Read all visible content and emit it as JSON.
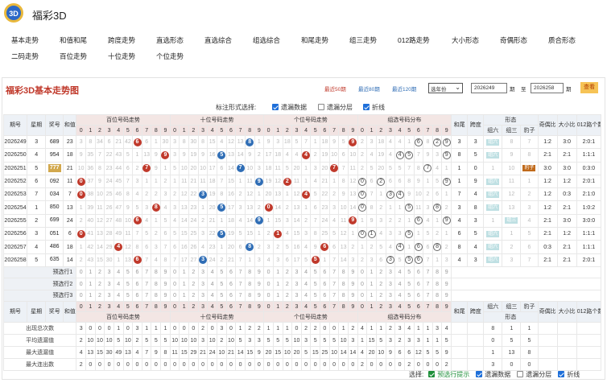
{
  "header": {
    "brand": "福彩3D",
    "logo_text": "3D"
  },
  "nav": {
    "row1": [
      "基本走势",
      "和值和尾",
      "跨度走势",
      "直选形态",
      "直选综合",
      "组选综合",
      "和尾走势",
      "组三走势",
      "012路走势",
      "大小形态",
      "奇偶形态",
      "质合形态"
    ],
    "row2": [
      "二码走势",
      "百位走势",
      "十位走势",
      "个位走势"
    ]
  },
  "panel": {
    "title": "福彩3D基本走势图",
    "recent": [
      "最近50期",
      "最近80期",
      "最近120期"
    ],
    "year_select": "选年份",
    "from_value": "2026249",
    "unit1": "期",
    "to_label": "至",
    "to_value": "2026258",
    "unit2": "期",
    "query": "查看"
  },
  "options": {
    "label": "标注形式选择:",
    "items": [
      {
        "label": "遗漏数据",
        "checked": true
      },
      {
        "label": "遗漏分层",
        "checked": false
      },
      {
        "label": "折线",
        "checked": true
      }
    ]
  },
  "table": {
    "h": {
      "qi": "期号",
      "week": "星期",
      "award": "奖号",
      "sum": "和值",
      "bai": "百位号码走势",
      "shi": "十位号码走势",
      "ge": "个位号码走势",
      "zuxuan": "组选号码分布",
      "hewei": "和尾",
      "kuadu": "跨度",
      "xingtai": "形态",
      "zu6": "组六",
      "zu3": "组三",
      "baozi": "豹子",
      "jo": "奇偶比",
      "dx": "大小比",
      "lu012": "012路个数比"
    },
    "digits": [
      "0",
      "1",
      "2",
      "3",
      "4",
      "5",
      "6",
      "7",
      "8",
      "9"
    ],
    "rows": [
      {
        "qi": "2026249",
        "week": "3",
        "award": "689",
        "sum": "23",
        "b": [
          "3",
          "8",
          "34",
          "6",
          "21",
          "42",
          "6",
          "6",
          "1",
          "30"
        ],
        "s": [
          "3",
          "8",
          "30",
          "8",
          "15",
          "4",
          "12",
          "13",
          "8",
          "1"
        ],
        "g": [
          "9",
          "3",
          "18",
          "5",
          "7",
          "1",
          "18",
          "9",
          "5",
          "9"
        ],
        "z": [
          "2",
          "3",
          "18",
          "4",
          "4",
          "1",
          "6",
          "8",
          "2",
          "9"
        ],
        "zc": [
          6,
          8,
          9
        ],
        "hw": "3",
        "kd": "3",
        "zu6": "组六",
        "zu3": "8",
        "bz": "7",
        "jo": "1:2",
        "dx": "3:0",
        "lu": "2:0:1"
      },
      {
        "qi": "2026250",
        "week": "4",
        "award": "954",
        "sum": "18",
        "b": [
          "9",
          "35",
          "7",
          "22",
          "43",
          "5",
          "1",
          "13",
          "9",
          "9"
        ],
        "s": [
          "3",
          "9",
          "19",
          "9",
          "16",
          "5",
          "13",
          "14",
          "9",
          "2"
        ],
        "g": [
          "17",
          "18",
          "4",
          "4",
          "4",
          "2",
          "19",
          "10",
          "6",
          "10"
        ],
        "z": [
          "2",
          "4",
          "19",
          "4",
          "4",
          "5",
          "7",
          "9",
          "3",
          "9"
        ],
        "zc": [
          4,
          5,
          9
        ],
        "hw": "8",
        "kd": "5",
        "zu6": "组六",
        "zu3": "9",
        "bz": "8",
        "jo": "2:1",
        "dx": "2:1",
        "lu": "1:1:1"
      },
      {
        "qi": "2026251",
        "week": "5",
        "award": "777",
        "sum": "21",
        "b": [
          "10",
          "36",
          "8",
          "23",
          "44",
          "6",
          "2",
          "7",
          "9",
          "1"
        ],
        "s": [
          "5",
          "10",
          "20",
          "10",
          "17",
          "6",
          "14",
          "7",
          "10",
          "3"
        ],
        "g": [
          "18",
          "11",
          "5",
          "20",
          "1",
          "3",
          "20",
          "7",
          "7",
          "11"
        ],
        "z": [
          "2",
          "5",
          "20",
          "5",
          "5",
          "7",
          "8",
          "7",
          "4",
          "1"
        ],
        "zc": [
          7
        ],
        "hw": "1",
        "kd": "0",
        "zu6": "1",
        "zu3": "10",
        "bz": "豹子",
        "jo": "3:0",
        "dx": "3:0",
        "lu": "0:3:0",
        "special": true
      },
      {
        "qi": "2026252",
        "week": "6",
        "award": "092",
        "sum": "11",
        "b": [
          "0",
          "37",
          "9",
          "24",
          "45",
          "7",
          "3",
          "1",
          "1",
          "2"
        ],
        "s": [
          "1",
          "11",
          "21",
          "11",
          "18",
          "7",
          "15",
          "1",
          "11",
          "9"
        ],
        "g": [
          "19",
          "12",
          "2",
          "11",
          "1",
          "4",
          "21",
          "1",
          "8",
          "12"
        ],
        "z": [
          "0",
          "6",
          "2",
          "6",
          "6",
          "8",
          "9",
          "1",
          "5",
          "9"
        ],
        "zc": [
          0,
          2,
          9
        ],
        "hw": "1",
        "kd": "9",
        "zu6": "组六",
        "zu3": "11",
        "bz": "1",
        "jo": "1:2",
        "dx": "1:2",
        "lu": "2:0:1"
      },
      {
        "qi": "2026253",
        "week": "7",
        "award": "034",
        "sum": "7",
        "b": [
          "0",
          "38",
          "10",
          "25",
          "46",
          "8",
          "4",
          "2",
          "2",
          "3"
        ],
        "s": [
          "2",
          "12",
          "22",
          "3",
          "19",
          "8",
          "16",
          "2",
          "12",
          "1"
        ],
        "g": [
          "20",
          "13",
          "1",
          "12",
          "4",
          "5",
          "22",
          "2",
          "9",
          "13"
        ],
        "z": [
          "0",
          "7",
          "1",
          "3",
          "4",
          "9",
          "10",
          "2",
          "6",
          "1"
        ],
        "zc": [
          0,
          3,
          4
        ],
        "hw": "7",
        "kd": "4",
        "zu6": "组六",
        "zu3": "12",
        "bz": "2",
        "jo": "1:2",
        "dx": "0:3",
        "lu": "2:1:0"
      },
      {
        "qi": "2026254",
        "week": "1",
        "award": "850",
        "sum": "13",
        "b": [
          "1",
          "39",
          "11",
          "26",
          "47",
          "9",
          "5",
          "3",
          "8",
          "4"
        ],
        "s": [
          "3",
          "13",
          "23",
          "1",
          "20",
          "5",
          "17",
          "3",
          "13",
          "2"
        ],
        "g": [
          "0",
          "14",
          "2",
          "13",
          "1",
          "6",
          "23",
          "3",
          "10",
          "14"
        ],
        "z": [
          "0",
          "8",
          "2",
          "1",
          "1",
          "5",
          "11",
          "3",
          "8",
          "2"
        ],
        "zc": [
          0,
          5,
          8
        ],
        "hw": "3",
        "kd": "8",
        "zu6": "组六",
        "zu3": "13",
        "bz": "3",
        "jo": "1:2",
        "dx": "2:1",
        "lu": "1:0:2"
      },
      {
        "qi": "2026255",
        "week": "2",
        "award": "699",
        "sum": "24",
        "b": [
          "2",
          "40",
          "12",
          "27",
          "48",
          "10",
          "6",
          "4",
          "1",
          "5"
        ],
        "s": [
          "4",
          "14",
          "24",
          "2",
          "21",
          "1",
          "18",
          "4",
          "14",
          "9"
        ],
        "g": [
          "1",
          "15",
          "3",
          "14",
          "2",
          "7",
          "24",
          "4",
          "11",
          "9"
        ],
        "z": [
          "1",
          "9",
          "3",
          "2",
          "2",
          "1",
          "6",
          "4",
          "1",
          "9"
        ],
        "zc": [
          6,
          9
        ],
        "hw": "4",
        "kd": "3",
        "zu6": "1",
        "zu3": "组三",
        "bz": "4",
        "jo": "2:1",
        "dx": "3:0",
        "lu": "3:0:0"
      },
      {
        "qi": "2026256",
        "week": "3",
        "award": "051",
        "sum": "6",
        "b": [
          "0",
          "41",
          "13",
          "28",
          "49",
          "11",
          "7",
          "5",
          "2",
          "6"
        ],
        "s": [
          "5",
          "15",
          "25",
          "3",
          "22",
          "5",
          "19",
          "5",
          "15",
          "1"
        ],
        "g": [
          "2",
          "1",
          "4",
          "15",
          "3",
          "8",
          "25",
          "5",
          "12",
          "1"
        ],
        "z": [
          "0",
          "1",
          "4",
          "3",
          "3",
          "5",
          "1",
          "5",
          "2",
          "1"
        ],
        "zc": [
          0,
          1,
          5
        ],
        "hw": "6",
        "kd": "5",
        "zu6": "组六",
        "zu3": "1",
        "bz": "5",
        "jo": "2:1",
        "dx": "1:2",
        "lu": "1:1:1"
      },
      {
        "qi": "2026257",
        "week": "4",
        "award": "486",
        "sum": "18",
        "b": [
          "1",
          "42",
          "14",
          "29",
          "4",
          "12",
          "8",
          "6",
          "3",
          "7"
        ],
        "s": [
          "6",
          "16",
          "26",
          "4",
          "23",
          "1",
          "20",
          "6",
          "8",
          "2"
        ],
        "g": [
          "3",
          "2",
          "5",
          "16",
          "4",
          "9",
          "6",
          "6",
          "13",
          "2"
        ],
        "z": [
          "1",
          "2",
          "5",
          "4",
          "4",
          "1",
          "6",
          "6",
          "8",
          "2"
        ],
        "zc": [
          4,
          6,
          8
        ],
        "hw": "8",
        "kd": "4",
        "zu6": "组六",
        "zu3": "2",
        "bz": "6",
        "jo": "0:3",
        "dx": "2:1",
        "lu": "1:1:1"
      },
      {
        "qi": "2026258",
        "week": "5",
        "award": "635",
        "sum": "14",
        "b": [
          "2",
          "43",
          "15",
          "30",
          "1",
          "13",
          "6",
          "7",
          "4",
          "8"
        ],
        "s": [
          "7",
          "17",
          "27",
          "3",
          "24",
          "2",
          "21",
          "7",
          "1",
          "3"
        ],
        "g": [
          "4",
          "3",
          "6",
          "17",
          "5",
          "5",
          "1",
          "7",
          "14",
          "3"
        ],
        "z": [
          "2",
          "3",
          "6",
          "3",
          "5",
          "5",
          "6",
          "7",
          "1",
          "3"
        ],
        "zc": [
          3,
          5,
          6
        ],
        "hw": "4",
        "kd": "3",
        "zu6": "组六",
        "zu3": "3",
        "bz": "7",
        "jo": "2:1",
        "dx": "2:1",
        "lu": "2:0:1"
      }
    ],
    "pre": [
      "预选行1",
      "预选行2",
      "预选行3"
    ],
    "stats": [
      {
        "label": "出现总次数",
        "b": [
          "3",
          "0",
          "0",
          "0",
          "1",
          "0",
          "3",
          "1",
          "1",
          "1"
        ],
        "s": [
          "0",
          "0",
          "0",
          "2",
          "0",
          "3",
          "0",
          "1",
          "2",
          "2"
        ],
        "g": [
          "1",
          "1",
          "1",
          "0",
          "2",
          "2",
          "0",
          "0",
          "1",
          "2"
        ],
        "z": [
          "4",
          "1",
          "1",
          "2",
          "3",
          "4",
          "1",
          "1",
          "3",
          "4"
        ],
        "zu6": "8",
        "zu3": "1",
        "bz": "1"
      },
      {
        "label": "平均遗漏值",
        "b": [
          "2",
          "10",
          "10",
          "10",
          "5",
          "10",
          "2",
          "5",
          "5",
          "5"
        ],
        "s": [
          "10",
          "10",
          "10",
          "3",
          "10",
          "2",
          "10",
          "5",
          "3",
          "3"
        ],
        "g": [
          "5",
          "5",
          "5",
          "10",
          "3",
          "5",
          "5",
          "5",
          "10",
          "3"
        ],
        "z": [
          "1",
          "15",
          "5",
          "3",
          "2",
          "3",
          "3",
          "1",
          "1",
          "5"
        ],
        "zu6": "0",
        "zu3": "5",
        "bz": "5"
      },
      {
        "label": "最大遗漏值",
        "b": [
          "4",
          "13",
          "15",
          "30",
          "49",
          "13",
          "4",
          "7",
          "9",
          "8"
        ],
        "s": [
          "11",
          "15",
          "29",
          "21",
          "24",
          "10",
          "21",
          "14",
          "15",
          "9"
        ],
        "g": [
          "20",
          "15",
          "10",
          "20",
          "5",
          "15",
          "25",
          "10",
          "14",
          "14"
        ],
        "z": [
          "4",
          "20",
          "10",
          "9",
          "6",
          "6",
          "12",
          "5",
          "5",
          "9"
        ],
        "zu6": "1",
        "zu3": "13",
        "bz": "8"
      },
      {
        "label": "最大连出数",
        "b": [
          "2",
          "0",
          "0",
          "0",
          "0",
          "0",
          "0",
          "0",
          "0",
          "0"
        ],
        "s": [
          "0",
          "0",
          "0",
          "0",
          "0",
          "0",
          "0",
          "0",
          "0",
          "0"
        ],
        "g": [
          "0",
          "0",
          "0",
          "0",
          "0",
          "0",
          "0",
          "0",
          "0",
          "0"
        ],
        "z": [
          "2",
          "0",
          "0",
          "0",
          "0",
          "2",
          "0",
          "0",
          "0",
          "2"
        ],
        "zu6": "3",
        "zu3": "0",
        "bz": "0"
      }
    ]
  },
  "bottom": {
    "label": "选择:",
    "items": [
      {
        "label": "预选行提示",
        "checked": true,
        "accent": true
      },
      {
        "label": "遗漏数据",
        "checked": true
      },
      {
        "label": "遗漏分层",
        "checked": false
      },
      {
        "label": "折线",
        "checked": true
      }
    ]
  },
  "colors": {
    "hit": "#c0392b",
    "blue": "#2f6db5",
    "title": "#c0392b",
    "award_bg": "#d2a84d"
  }
}
